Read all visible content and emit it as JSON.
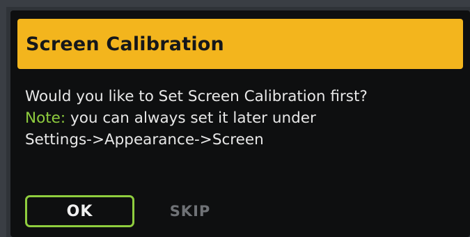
{
  "dialog": {
    "title": "Screen Calibration",
    "message_line1": "Would you like to Set Screen Calibration first?",
    "note_label": "Note:",
    "note_text": " you can always set it later under",
    "message_line3": "Settings->Appearance->Screen"
  },
  "buttons": {
    "ok_label": "OK",
    "skip_label": "SKIP"
  },
  "colors": {
    "title_bar": "#f3b51d",
    "accent_green": "#8fcd3e",
    "dialog_background": "#0e0f10",
    "skip_text": "#6f7276"
  }
}
